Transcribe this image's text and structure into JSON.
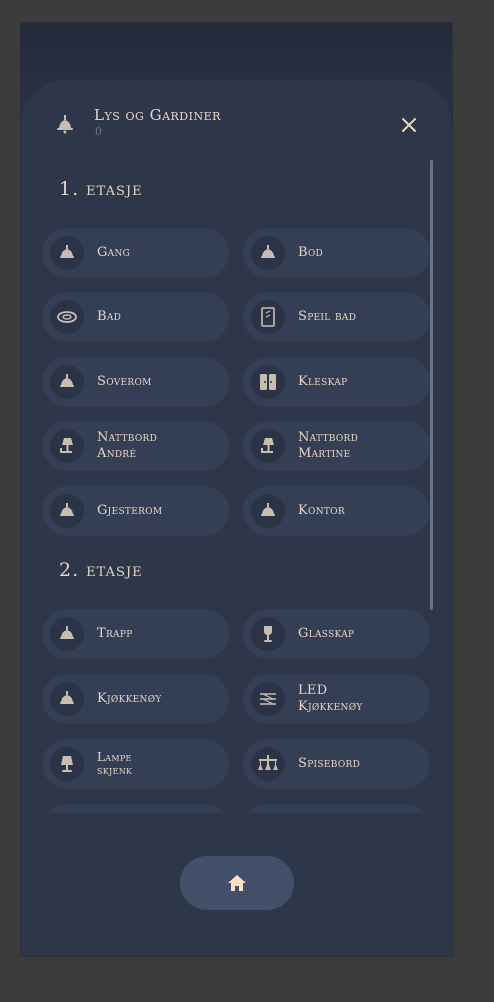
{
  "header": {
    "title": "Lys og Gardiner",
    "subtitle": "0",
    "icon": "ceiling-lamp-icon",
    "close_icon": "close-icon"
  },
  "sections": [
    {
      "title": "1. etasje",
      "tiles": [
        {
          "label": "Gang",
          "icon": "ceiling-lamp-icon"
        },
        {
          "label": "Bod",
          "icon": "ceiling-lamp-icon"
        },
        {
          "label": "Bad",
          "icon": "ceiling-light-round-icon"
        },
        {
          "label": "Speil bad",
          "icon": "mirror-light-icon"
        },
        {
          "label": "Soverom",
          "icon": "ceiling-lamp-icon"
        },
        {
          "label": "Kleskap",
          "icon": "wardrobe-icon"
        },
        {
          "label": "Nattbord André",
          "icon": "desk-lamp-icon"
        },
        {
          "label": "Nattbord Martine",
          "icon": "desk-lamp-icon"
        },
        {
          "label": "Gjesterom",
          "icon": "ceiling-lamp-icon"
        },
        {
          "label": "Kontor",
          "icon": "ceiling-lamp-icon"
        }
      ]
    },
    {
      "title": "2. etasje",
      "tiles": [
        {
          "label": "Trapp",
          "icon": "ceiling-lamp-icon"
        },
        {
          "label": "Glasskap",
          "icon": "wine-glass-icon"
        },
        {
          "label": "Kjøkkenøy",
          "icon": "ceiling-lamp-icon"
        },
        {
          "label": "LED Kjøkkenøy",
          "icon": "led-strip-icon"
        },
        {
          "label": "Lampe skjenk",
          "icon": "table-lamp-icon"
        },
        {
          "label": "Spisebord",
          "icon": "chandelier-icon"
        }
      ]
    }
  ],
  "footer": {
    "home_icon": "home-icon"
  },
  "colors": {
    "accent": "#e8d6c3",
    "panel": "#2d3749",
    "tile": "#343f55"
  }
}
